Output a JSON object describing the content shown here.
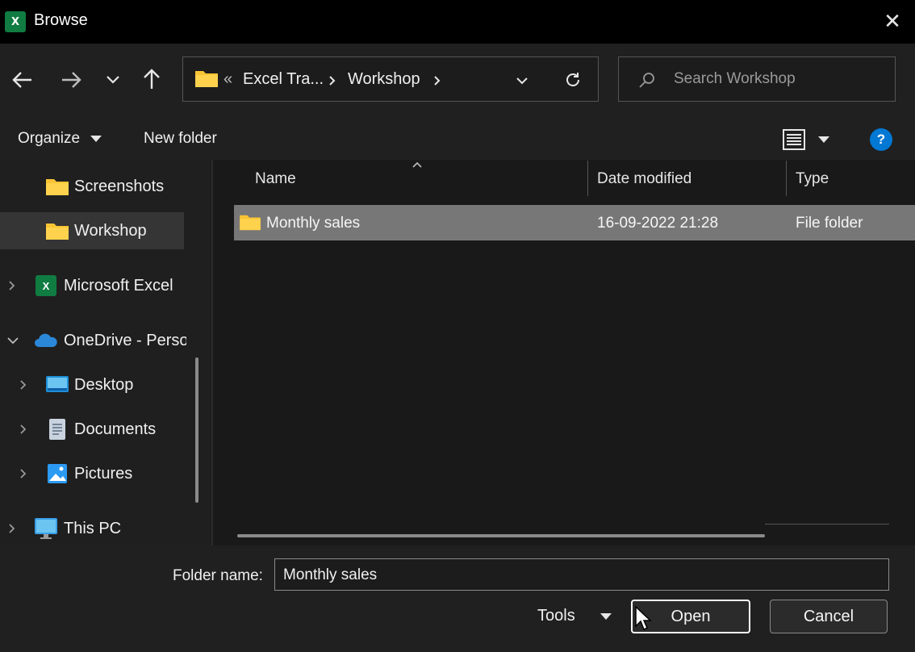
{
  "window": {
    "title": "Browse",
    "app_icon_letter": "X",
    "close_glyph": "✕"
  },
  "nav": {
    "breadcrumb_prefix": "«",
    "breadcrumb": [
      "Excel Tra...",
      "Workshop"
    ],
    "search_placeholder": "Search Workshop"
  },
  "commands": {
    "organize": "Organize",
    "new_folder": "New folder"
  },
  "sidebar": {
    "items": [
      {
        "label": "Screenshots",
        "icon": "folder-icon"
      },
      {
        "label": "Workshop",
        "icon": "folder-icon",
        "selected": true
      },
      {
        "label": "Microsoft Excel",
        "icon": "excel-icon"
      },
      {
        "label": "OneDrive - Perso",
        "icon": "onedrive-icon"
      },
      {
        "label": "Desktop",
        "icon": "desktop-icon"
      },
      {
        "label": "Documents",
        "icon": "documents-icon"
      },
      {
        "label": "Pictures",
        "icon": "pictures-icon"
      },
      {
        "label": "This PC",
        "icon": "pc-icon"
      }
    ]
  },
  "columns": {
    "name": "Name",
    "date": "Date modified",
    "type": "Type"
  },
  "files": [
    {
      "name": "Monthly sales",
      "date": "16-09-2022 21:28",
      "type": "File folder"
    }
  ],
  "bottom": {
    "folder_name_label": "Folder name:",
    "folder_name_value": "Monthly sales",
    "tools": "Tools",
    "open": "Open",
    "cancel": "Cancel"
  },
  "colors": {
    "folder": "#f8c434",
    "excel_green": "#107c41",
    "help_blue": "#0078d4",
    "onedrive_blue": "#2b88d8"
  }
}
